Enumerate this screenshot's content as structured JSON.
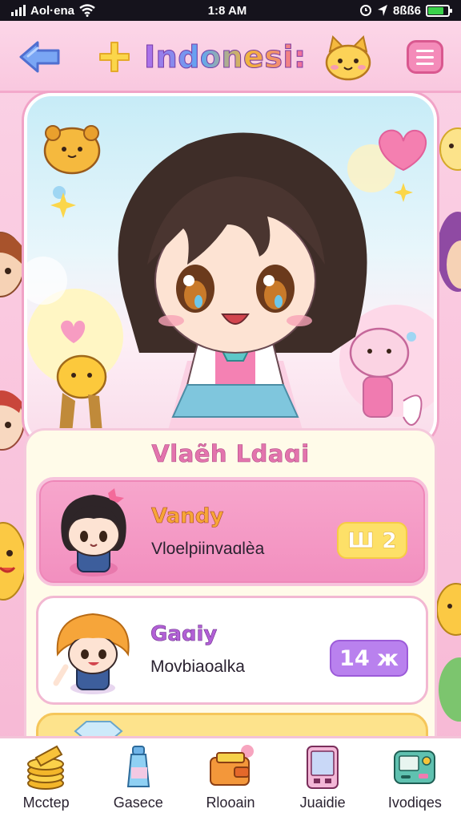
{
  "status_bar": {
    "carrier": "Aol·ena",
    "time": "1:8 AM",
    "battery_text": "8ßß6",
    "battery_level": 0.8
  },
  "header": {
    "title": "Indonesi:",
    "back_icon": "arrow-left-icon",
    "add_icon": "plus-icon",
    "menu_icon": "hamburger-menu-icon"
  },
  "leaderboard": {
    "title": "Vlaẽh Ldaɑi",
    "entries": [
      {
        "name": "Vandy",
        "subtitle": "Vloelpiinvaɑlèa",
        "score": "Ш 2"
      },
      {
        "name": "Gaɑiy",
        "subtitle": "Movbiaoalka",
        "score": "14 ж"
      }
    ]
  },
  "bottom_nav": {
    "items": [
      {
        "label": "Mcctep",
        "icon": "coin-stack-icon"
      },
      {
        "label": "Gasece",
        "icon": "potion-bottle-icon"
      },
      {
        "label": "Rlooain",
        "icon": "wallet-icon"
      },
      {
        "label": "Juaidie",
        "icon": "phone-screen-icon"
      },
      {
        "label": "Ivodiqes",
        "icon": "game-console-icon"
      }
    ]
  },
  "colors": {
    "page_pink": "#f9c3dc",
    "accent_pink": "#f28fbf",
    "gold": "#fde068",
    "purple": "#b981ee",
    "status_bar": "#15131c"
  }
}
